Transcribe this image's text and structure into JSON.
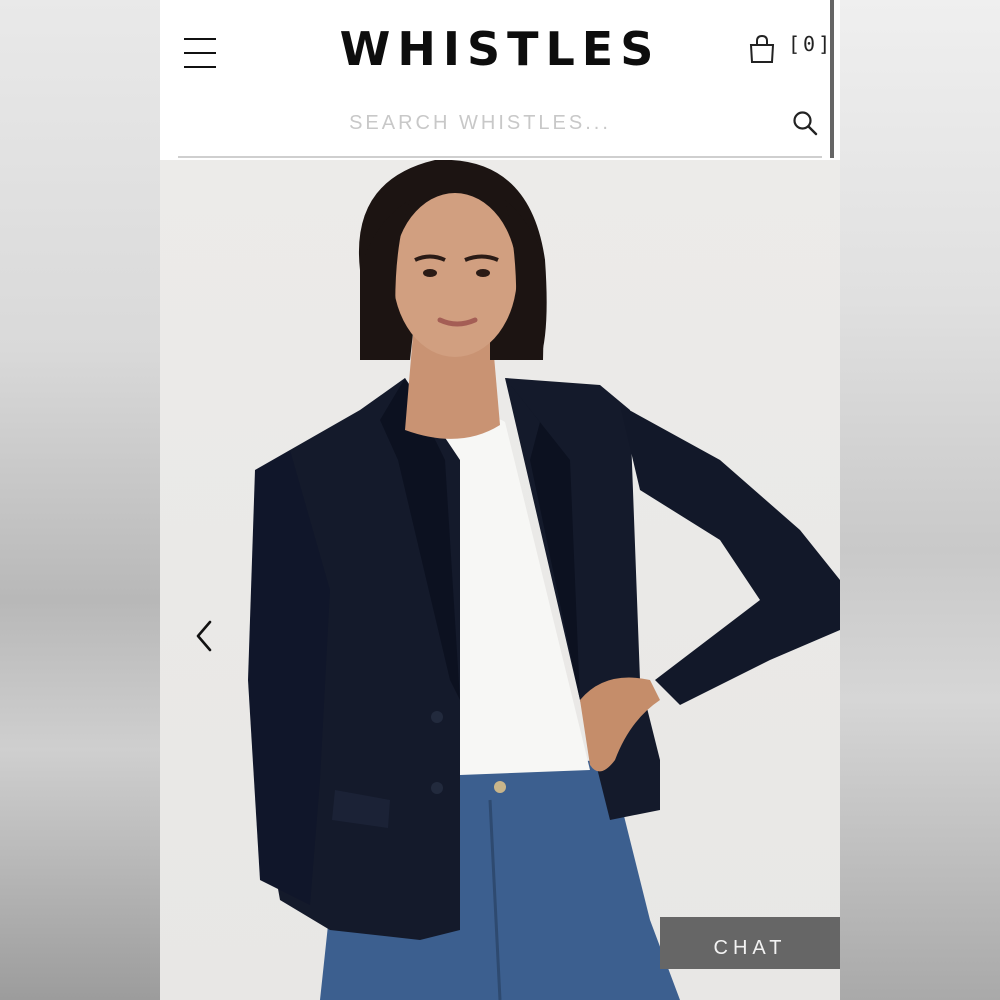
{
  "header": {
    "logo": "WHISTLES",
    "cart_count": "[0]"
  },
  "search": {
    "placeholder": "SEARCH WHISTLES..."
  },
  "gallery": {
    "image_alt": "Woman wearing navy jersey blazer, white t-shirt and blue jeans"
  },
  "chat": {
    "label": "CHAT"
  },
  "colors": {
    "chat_bg": "#666666",
    "logo": "#0d0d0d",
    "blazer": "#141a2b",
    "denim": "#3c5f8f"
  },
  "icons": [
    "menu-icon",
    "shopping-bag-icon",
    "search-icon",
    "chevron-left-icon"
  ]
}
